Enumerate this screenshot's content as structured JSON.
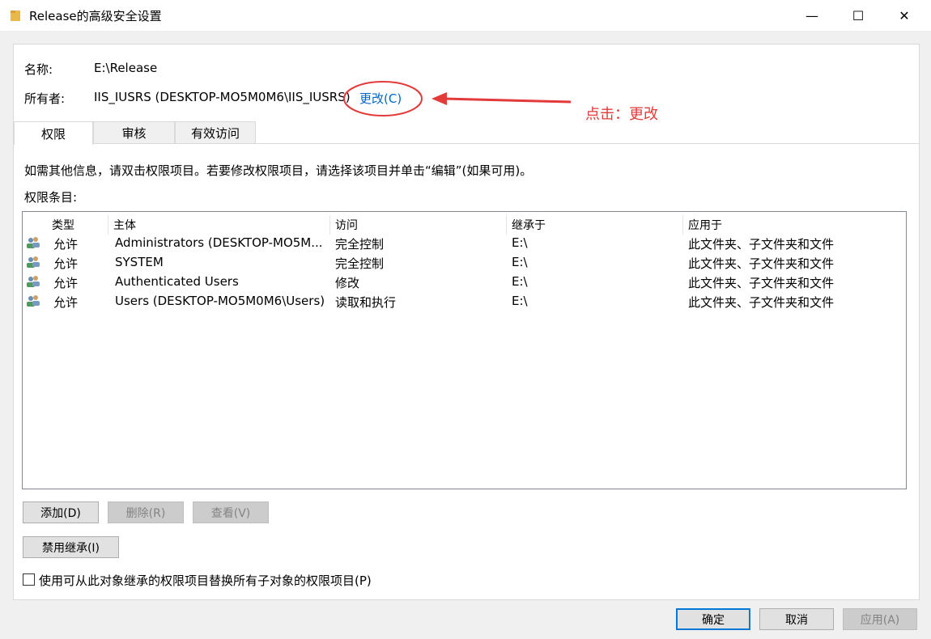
{
  "window": {
    "title": "Release的高级安全设置",
    "minimize": "—",
    "maximize": "☐",
    "close": "✕"
  },
  "info": {
    "name_label": "名称:",
    "name_value": "E:\\Release",
    "owner_label": "所有者:",
    "owner_value": "IIS_IUSRS (DESKTOP-MO5M0M6\\IIS_IUSRS)",
    "change_link": "更改(C)"
  },
  "tabs": [
    {
      "label": "权限",
      "active": true
    },
    {
      "label": "审核",
      "active": false
    },
    {
      "label": "有效访问",
      "active": false
    }
  ],
  "permissions": {
    "hint": "如需其他信息，请双击权限项目。若要修改权限项目，请选择该项目并单击“编辑”(如果可用)。",
    "entries_label": "权限条目:",
    "columns": [
      "类型",
      "主体",
      "访问",
      "继承于",
      "应用于"
    ],
    "rows": [
      {
        "type": "允许",
        "principal": "Administrators (DESKTOP-MO5M...",
        "access": "完全控制",
        "inherited": "E:\\",
        "applies": "此文件夹、子文件夹和文件"
      },
      {
        "type": "允许",
        "principal": "SYSTEM",
        "access": "完全控制",
        "inherited": "E:\\",
        "applies": "此文件夹、子文件夹和文件"
      },
      {
        "type": "允许",
        "principal": "Authenticated Users",
        "access": "修改",
        "inherited": "E:\\",
        "applies": "此文件夹、子文件夹和文件"
      },
      {
        "type": "允许",
        "principal": "Users (DESKTOP-MO5M0M6\\Users)",
        "access": "读取和执行",
        "inherited": "E:\\",
        "applies": "此文件夹、子文件夹和文件"
      }
    ]
  },
  "buttons": {
    "add": "添加(D)",
    "remove": "删除(R)",
    "view": "查看(V)",
    "disable_inheritance": "禁用继承(I)",
    "ok": "确定",
    "cancel": "取消",
    "apply": "应用(A)"
  },
  "replace_checkbox": {
    "label": "使用可从此对象继承的权限项目替换所有子对象的权限项目(P)",
    "checked": false
  },
  "annotation": {
    "text": "点击：更改",
    "color": "#e33a3a"
  }
}
